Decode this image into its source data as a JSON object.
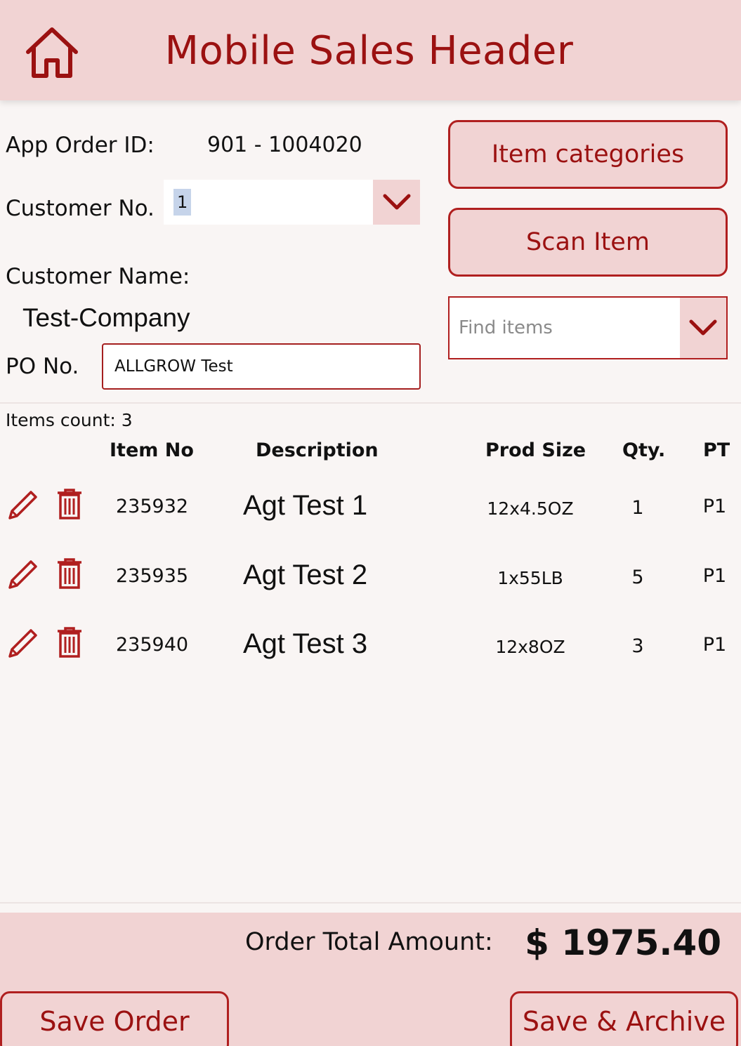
{
  "header": {
    "title": "Mobile Sales Header",
    "home_icon": "home-icon"
  },
  "order": {
    "app_order_id_label": "App Order ID:",
    "app_order_id_value": "901 - 1004020",
    "customer_no_label": "Customer No.",
    "customer_no_value": "1",
    "customer_name_label": "Customer Name:",
    "customer_name_value": "Test-Company",
    "po_label": "PO No.",
    "po_value": "ALLGROW Test"
  },
  "actions": {
    "item_categories": "Item categories",
    "scan_item": "Scan Item",
    "find_items_placeholder": "Find items"
  },
  "items": {
    "count_label": "Items count: 3",
    "columns": [
      "Item No",
      "Description",
      "Prod Size",
      "Qty.",
      "PT"
    ],
    "rows": [
      {
        "item_no": "235932",
        "description": "Agt Test 1",
        "prod_size": "12x4.5OZ",
        "qty": "1",
        "pt": "P1"
      },
      {
        "item_no": "235935",
        "description": "Agt Test 2",
        "prod_size": "1x55LB",
        "qty": "5",
        "pt": "P1"
      },
      {
        "item_no": "235940",
        "description": "Agt Test 3",
        "prod_size": "12x8OZ",
        "qty": "3",
        "pt": "P1"
      }
    ]
  },
  "footer": {
    "total_label": "Order Total Amount:",
    "total_value": "$ 1975.40",
    "save_order": "Save Order",
    "save_archive": "Save & Archive"
  },
  "colors": {
    "accent": "#9b1111",
    "panel": "#f1d3d3",
    "border": "#b01f1f",
    "background": "#f9f5f4"
  }
}
